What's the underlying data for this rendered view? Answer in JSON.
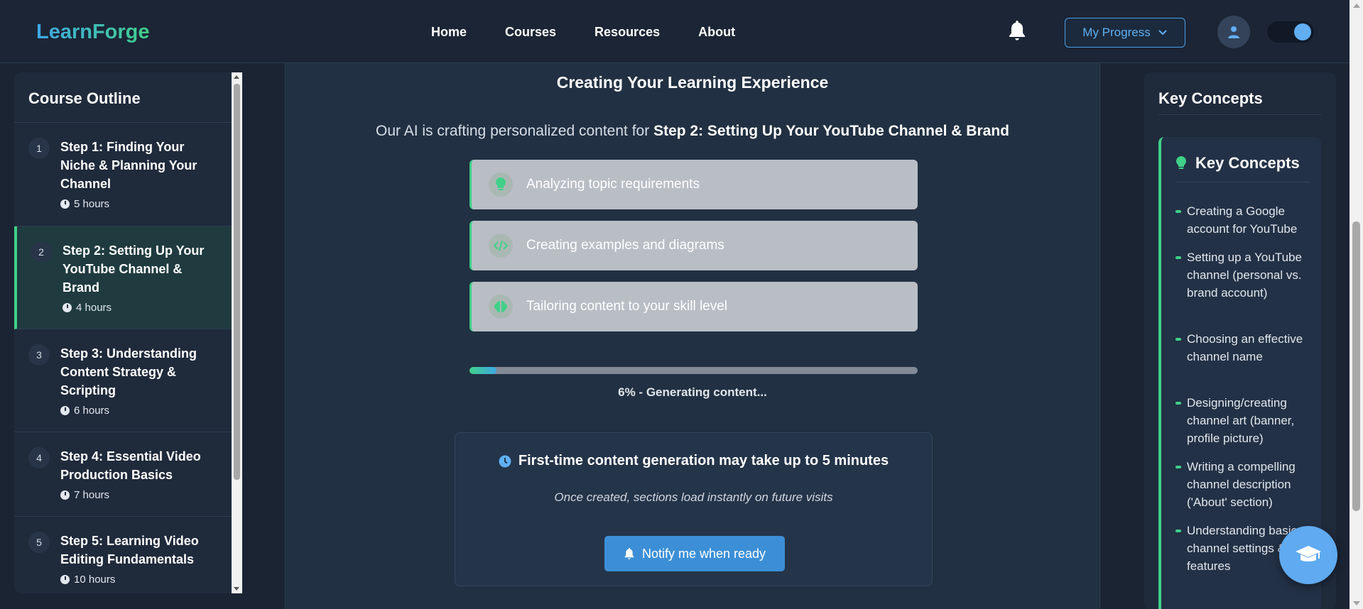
{
  "header": {
    "logo": "LearnForge",
    "nav": [
      "Home",
      "Courses",
      "Resources",
      "About"
    ],
    "progress_button": "My Progress",
    "accent": "#40d089",
    "brand_blue": "#3fa8e6"
  },
  "sidebar": {
    "title": "Course Outline",
    "steps": [
      {
        "num": "1",
        "title": "Step 1: Finding Your Niche & Planning Your Channel",
        "hours": "5 hours"
      },
      {
        "num": "2",
        "title": "Step 2: Setting Up Your YouTube Channel & Brand",
        "hours": "4 hours",
        "active": true
      },
      {
        "num": "3",
        "title": "Step 3: Understanding Content Strategy & Scripting",
        "hours": "6 hours"
      },
      {
        "num": "4",
        "title": "Step 4: Essential Video Production Basics",
        "hours": "7 hours"
      },
      {
        "num": "5",
        "title": "Step 5: Learning Video Editing Fundamentals",
        "hours": "10 hours"
      }
    ]
  },
  "main": {
    "title": "Creating Your Learning Experience",
    "subtitle_prefix": "Our AI is crafting personalized content for",
    "subtitle_topic": "Step 2: Setting Up Your YouTube Channel & Brand",
    "tasks": [
      {
        "label": "Analyzing topic requirements",
        "icon": "lightbulb-icon"
      },
      {
        "label": "Creating examples and diagrams",
        "icon": "code-icon"
      },
      {
        "label": "Tailoring content to your skill level",
        "icon": "brain-icon"
      }
    ],
    "progress_percent": 6,
    "progress_text": "6% - Generating content...",
    "notice_title": "First-time content generation may take up to 5 minutes",
    "notice_sub": "Once created, sections load instantly on future visits",
    "notify_button": "Notify me when ready"
  },
  "right": {
    "title": "Key Concepts",
    "card_title": "Key Concepts",
    "items": [
      "Creating a Google account for YouTube",
      "Setting up a YouTube channel (personal vs. brand account)",
      "Choosing an effective channel name",
      "Designing/creating channel art (banner, profile picture)",
      "Writing a compelling channel description ('About' section)",
      "Understanding basic channel settings & features"
    ]
  }
}
